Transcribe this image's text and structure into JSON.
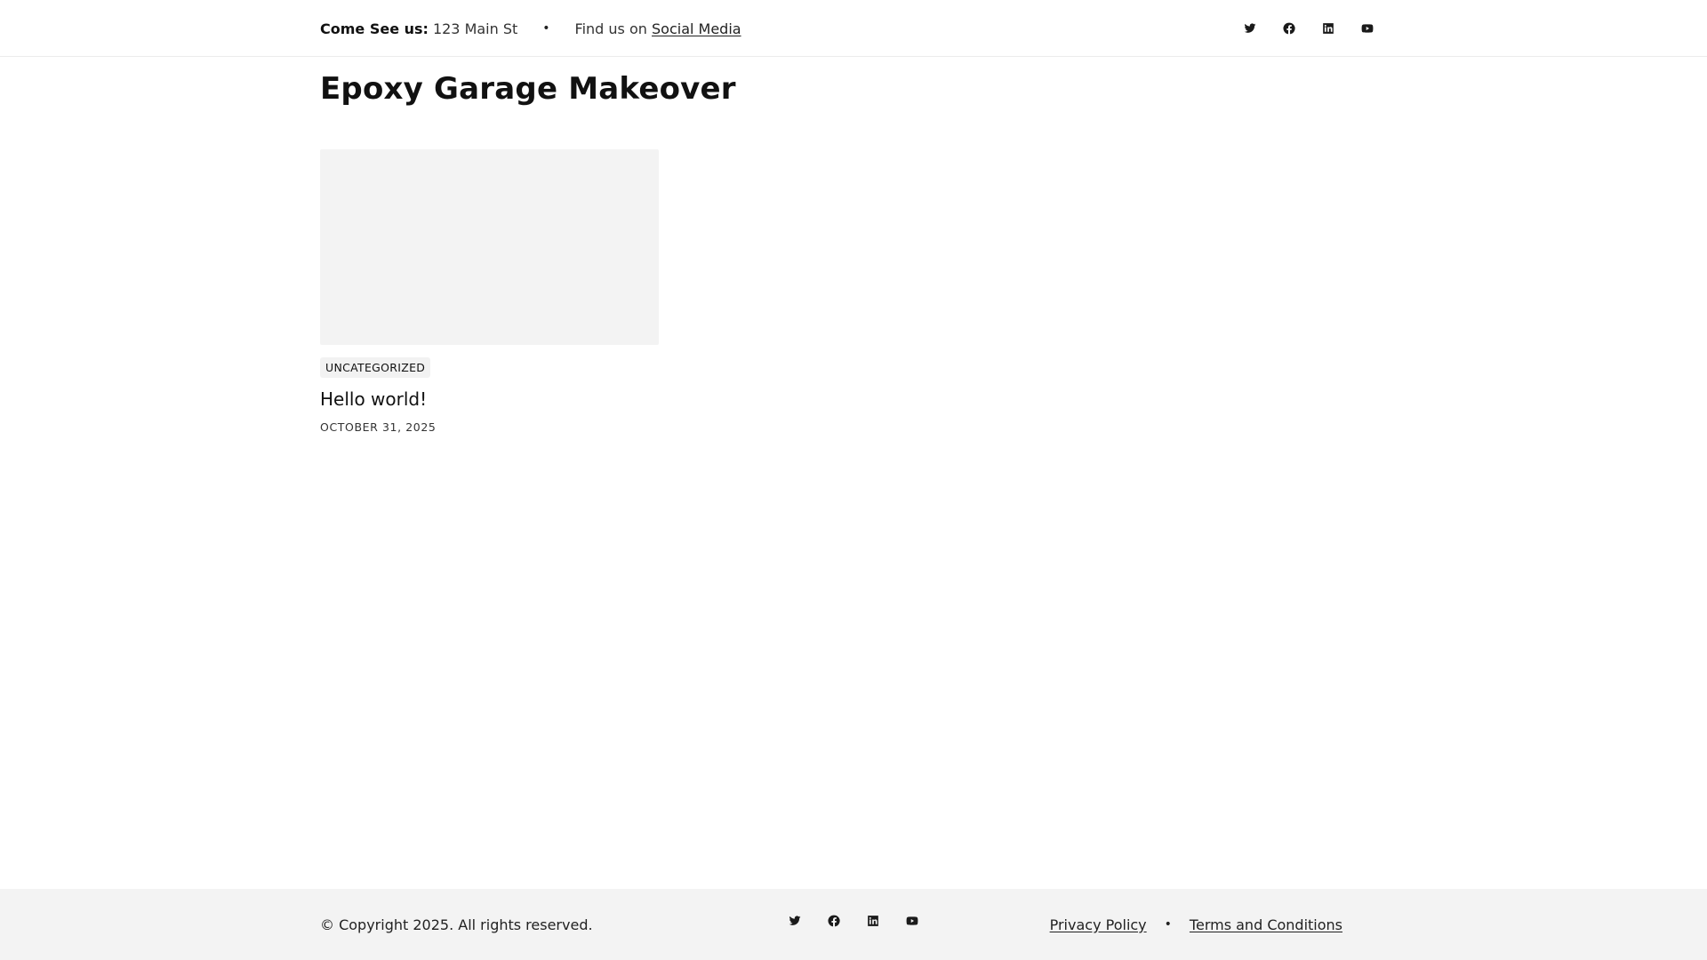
{
  "topbar": {
    "address_label": "Come See us:",
    "address_value": "123 Main St",
    "separator": "•",
    "find_prefix": "Find us on",
    "find_link": "Social Media",
    "social_icons": [
      "twitter-icon",
      "facebook-icon",
      "linkedin-icon",
      "youtube-icon"
    ]
  },
  "page": {
    "title": "Epoxy Garage Makeover"
  },
  "posts": [
    {
      "category": "UNCATEGORIZED",
      "title": "Hello world!",
      "date": "OCTOBER 31, 2025"
    }
  ],
  "footer": {
    "copyright": "© Copyright 2025. All rights reserved.",
    "links": [
      "Privacy Policy",
      "Terms and Conditions"
    ],
    "separator": "•",
    "social_icons": [
      "twitter-icon",
      "facebook-icon",
      "linkedin-icon",
      "youtube-icon"
    ]
  },
  "colors": {
    "text": "#111111",
    "footer_bg": "#f3f3f3",
    "thumb_bg": "#f3f3f3",
    "divider": "#ececec"
  }
}
